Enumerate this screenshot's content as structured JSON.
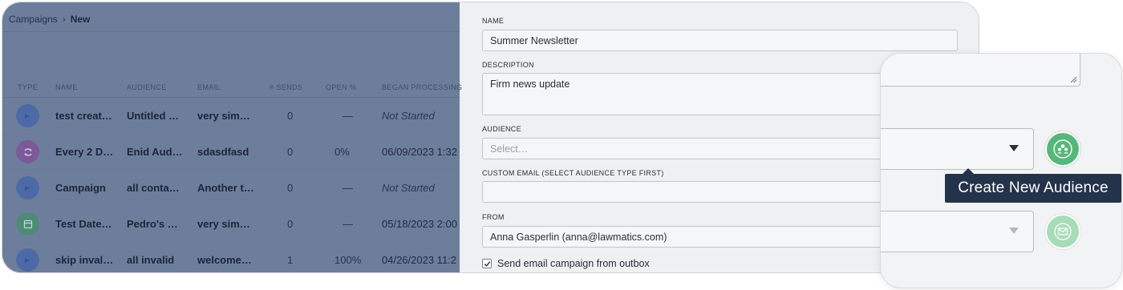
{
  "breadcrumb": {
    "parent": "Campaigns",
    "current": "New"
  },
  "table": {
    "columns": [
      "TYPE",
      "NAME",
      "AUDIENCE",
      "EMAIL",
      "# SENDS",
      "OPEN %",
      "BEGAN PROCESSING"
    ],
    "rows": [
      {
        "type_icon": "send-icon",
        "name": "test creat…",
        "audience": "Untitled …",
        "email": "very sim…",
        "sends": "0",
        "open": "—",
        "began": "Not Started",
        "icon_color": "#4d6aa6"
      },
      {
        "type_icon": "recurring-icon",
        "name": "Every 2 D…",
        "audience": "Enid Aud…",
        "email": "sdasdfasd",
        "sends": "0",
        "open": "0%",
        "began": "06/09/2023 1:32",
        "icon_color": "#7a5a98"
      },
      {
        "type_icon": "send-icon",
        "name": "Campaign",
        "audience": "all conta…",
        "email": "Another t…",
        "sends": "0",
        "open": "—",
        "began": "Not Started",
        "icon_color": "#4d6aa6"
      },
      {
        "type_icon": "calendar-icon",
        "name": "Test Date…",
        "audience": "Pedro's …",
        "email": "very sim…",
        "sends": "0",
        "open": "—",
        "began": "05/18/2023 2:00",
        "icon_color": "#4f8a78"
      },
      {
        "type_icon": "send-icon",
        "name": "skip inval…",
        "audience": "all invalid",
        "email": "welcome…",
        "sends": "1",
        "open": "100%",
        "began": "04/26/2023 11:2",
        "icon_color": "#4d6aa6"
      }
    ]
  },
  "form": {
    "name_label": "NAME",
    "name_value": "Summer Newsletter",
    "description_label": "DESCRIPTION",
    "description_value": "Firm news update",
    "audience_label": "AUDIENCE",
    "audience_placeholder": "Select…",
    "custom_email_label": "CUSTOM EMAIL (SELECT AUDIENCE TYPE FIRST)",
    "from_label": "FROM",
    "from_value": "Anna Gasperlin (anna@lawmatics.com)",
    "outbox_label": "Send email campaign from outbox",
    "outbox_checked": true
  },
  "zoom": {
    "tooltip": "Create New Audience",
    "create_audience_color": "#55b87a",
    "email_button_color": "#a8dcb8"
  }
}
